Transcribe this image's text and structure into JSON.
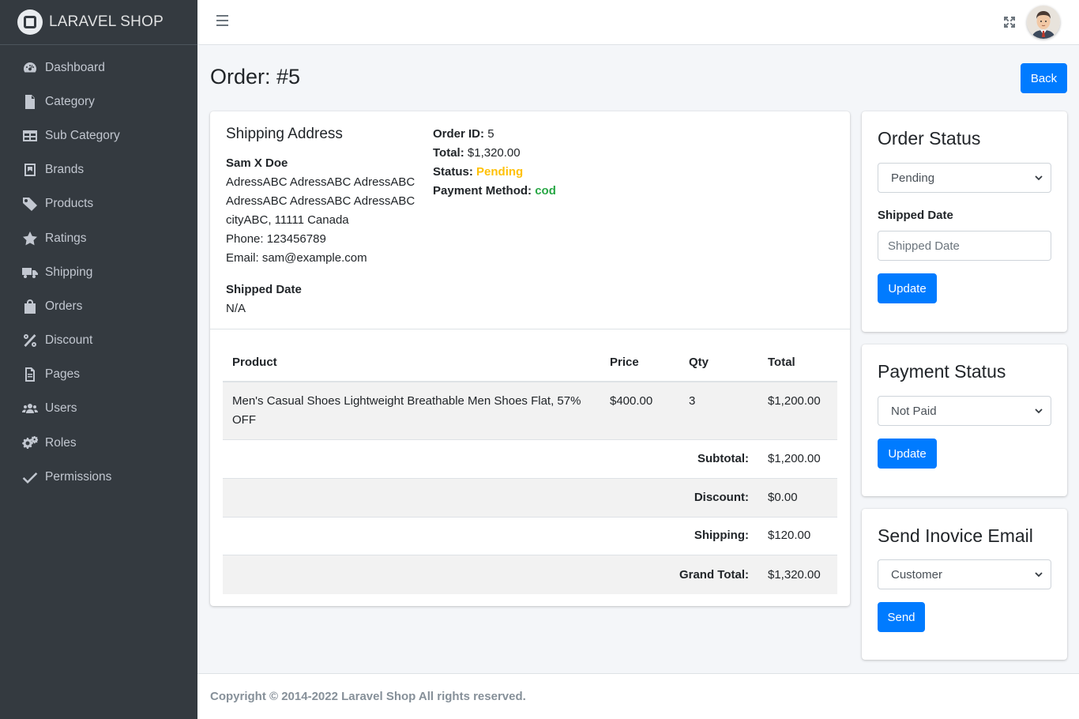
{
  "brand": {
    "name": "LARAVEL SHOP"
  },
  "sidebar": {
    "items": [
      {
        "label": "Dashboard",
        "icon": "tachometer-icon"
      },
      {
        "label": "Category",
        "icon": "file-icon"
      },
      {
        "label": "Sub Category",
        "icon": "table-icon"
      },
      {
        "label": "Brands",
        "icon": "book-icon"
      },
      {
        "label": "Products",
        "icon": "tag-icon"
      },
      {
        "label": "Ratings",
        "icon": "star-icon"
      },
      {
        "label": "Shipping",
        "icon": "truck-icon"
      },
      {
        "label": "Orders",
        "icon": "shopping-bag-icon"
      },
      {
        "label": "Discount",
        "icon": "percent-icon"
      },
      {
        "label": "Pages",
        "icon": "file-alt-icon"
      },
      {
        "label": "Users",
        "icon": "users-icon"
      },
      {
        "label": "Roles",
        "icon": "cogs-icon"
      },
      {
        "label": "Permissions",
        "icon": "check-icon"
      }
    ]
  },
  "page": {
    "title": "Order: #5",
    "back_label": "Back"
  },
  "shipping": {
    "title": "Shipping Address",
    "name": "Sam X Doe",
    "address_lines": [
      "AdressABC AdressABC AdressABC",
      "AdressABC AdressABC AdressABC",
      "cityABC, 11111 Canada"
    ],
    "phone": "Phone: 123456789",
    "email": "Email: sam@example.com",
    "shipped_date_label": "Shipped Date",
    "shipped_date_value": "N/A"
  },
  "order": {
    "id_label": "Order ID:",
    "id_value": "5",
    "total_label": "Total:",
    "total_value": "$1,320.00",
    "status_label": "Status:",
    "status_value": "Pending",
    "payment_label": "Payment Method:",
    "payment_value": "cod"
  },
  "table": {
    "headers": [
      "Product",
      "Price",
      "Qty",
      "Total"
    ],
    "rows": [
      {
        "product": "Men's Casual Shoes Lightweight Breathable Men Shoes Flat, 57% OFF",
        "price": "$400.00",
        "qty": "3",
        "total": "$1,200.00"
      }
    ],
    "summary": [
      {
        "label": "Subtotal:",
        "value": "$1,200.00"
      },
      {
        "label": "Discount:",
        "value": "$0.00"
      },
      {
        "label": "Shipping:",
        "value": "$120.00"
      },
      {
        "label": "Grand Total:",
        "value": "$1,320.00"
      }
    ]
  },
  "order_status_card": {
    "title": "Order Status",
    "selected": "Pending",
    "shipped_label": "Shipped Date",
    "shipped_placeholder": "Shipped Date",
    "button": "Update"
  },
  "payment_status_card": {
    "title": "Payment Status",
    "selected": "Not Paid",
    "button": "Update"
  },
  "invoice_card": {
    "title": "Send Inovice Email",
    "selected": "Customer",
    "button": "Send"
  },
  "footer": {
    "text": "Copyright © 2014-2022 Laravel Shop All rights reserved."
  },
  "colors": {
    "primary": "#007bff",
    "warning": "#ffc107",
    "success": "#28a745",
    "sidebar": "#343a40"
  }
}
